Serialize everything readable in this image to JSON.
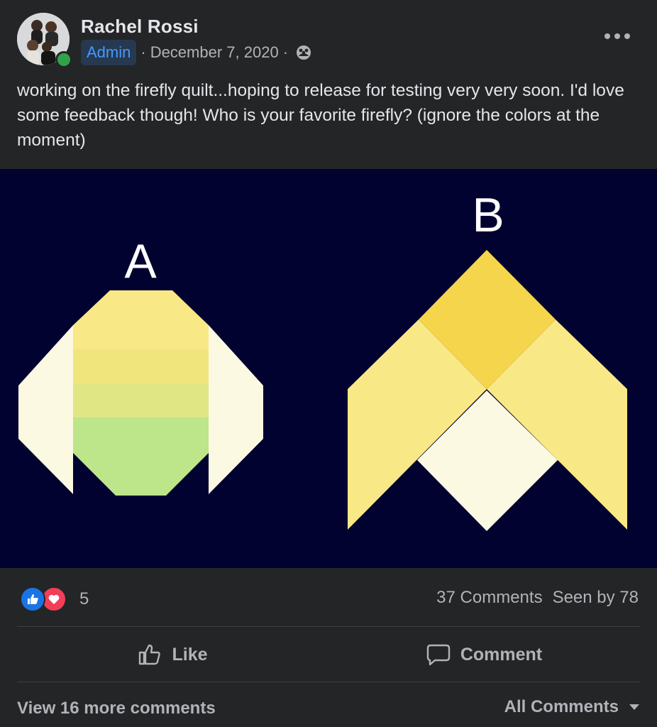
{
  "post": {
    "author": "Rachel Rossi",
    "badge": "Admin",
    "separator": "·",
    "date": "December 7, 2020",
    "audience_icon": "group-icon",
    "more_icon": "more-options-icon",
    "text": "working on the firefly quilt...hoping to release for testing very very soon. I'd love some feedback though! Who is your favorite firefly? (ignore the colors at the moment)"
  },
  "image": {
    "background": "#010230",
    "label_a": "A",
    "label_b": "B",
    "colors": {
      "cream": "#fcf9e3",
      "yellow_light": "#f9e886",
      "yellow_mid": "#f0e57d",
      "yellow_gold": "#f5d54b",
      "yellow_green": "#e0e684",
      "green": "#bde58a"
    }
  },
  "engagement": {
    "reaction_icons": [
      "like-icon",
      "love-icon"
    ],
    "reaction_count": "5",
    "comments": "37 Comments",
    "seen": "Seen by 78"
  },
  "actions": {
    "like_label": "Like",
    "comment_label": "Comment"
  },
  "footer": {
    "view_more": "View 16 more comments",
    "all_comments": "All Comments"
  },
  "colors": {
    "background": "#242526",
    "text_primary": "#e4e6eb",
    "text_secondary": "#b0b3b8",
    "badge_bg": "#263951",
    "badge_text": "#4599ff",
    "online": "#31a24c",
    "like": "#1b74e4",
    "love": "#f33e58"
  }
}
